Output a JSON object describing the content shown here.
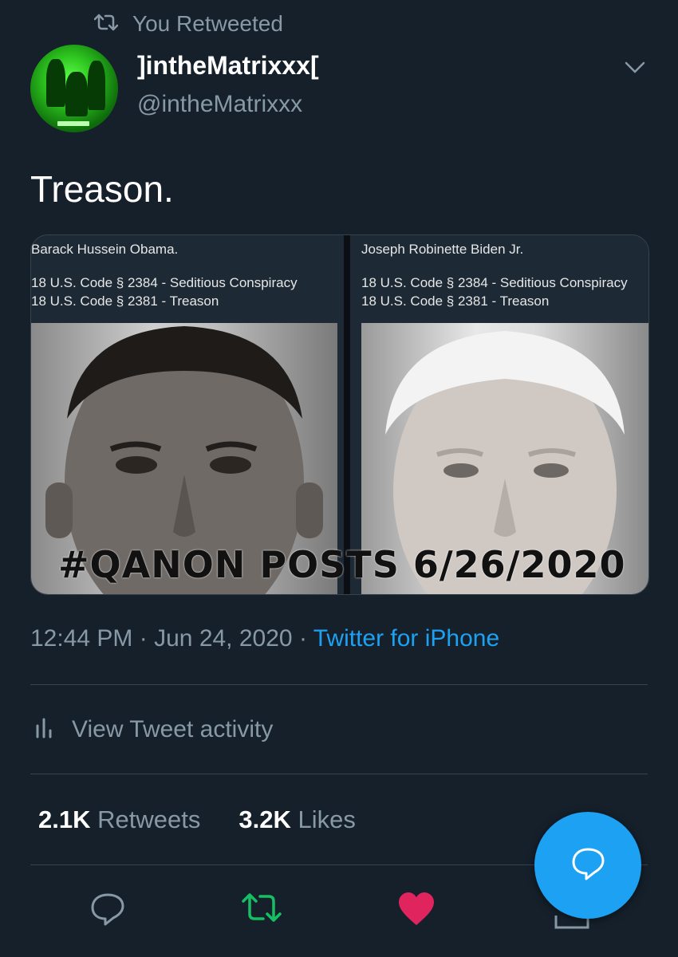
{
  "retweet_context": {
    "label": "You Retweeted"
  },
  "author": {
    "display_name": "]intheMatrixxx[",
    "handle": "@intheMatrixxx"
  },
  "tweet": {
    "text": "Treason."
  },
  "media": {
    "left_name": "Barack Hussein Obama.",
    "right_name": "Joseph Robinette Biden Jr.",
    "code_line_1": "18 U.S. Code § 2384 - Seditious Conspiracy",
    "code_line_2": "18 U.S. Code § 2381 - Treason",
    "overlay_text": "#QANON POSTS 6/26/2020"
  },
  "meta": {
    "time": "12:44 PM",
    "sep": "·",
    "date": "Jun 24, 2020",
    "source": "Twitter for iPhone"
  },
  "activity": {
    "label": "View Tweet activity"
  },
  "stats": {
    "retweets_count": "2.1K",
    "retweets_label": "Retweets",
    "likes_count": "3.2K",
    "likes_label": "Likes"
  },
  "colors": {
    "background": "#15202b",
    "accent": "#1da1f2",
    "retweet_green": "#17bf63",
    "like_red": "#e0245e",
    "muted": "#8899a6"
  },
  "icons": [
    "retweet-icon",
    "chevron-down-icon",
    "bar-chart-icon",
    "reply-icon",
    "retweet-icon",
    "heart-icon",
    "share-icon",
    "compose-reply-icon"
  ]
}
